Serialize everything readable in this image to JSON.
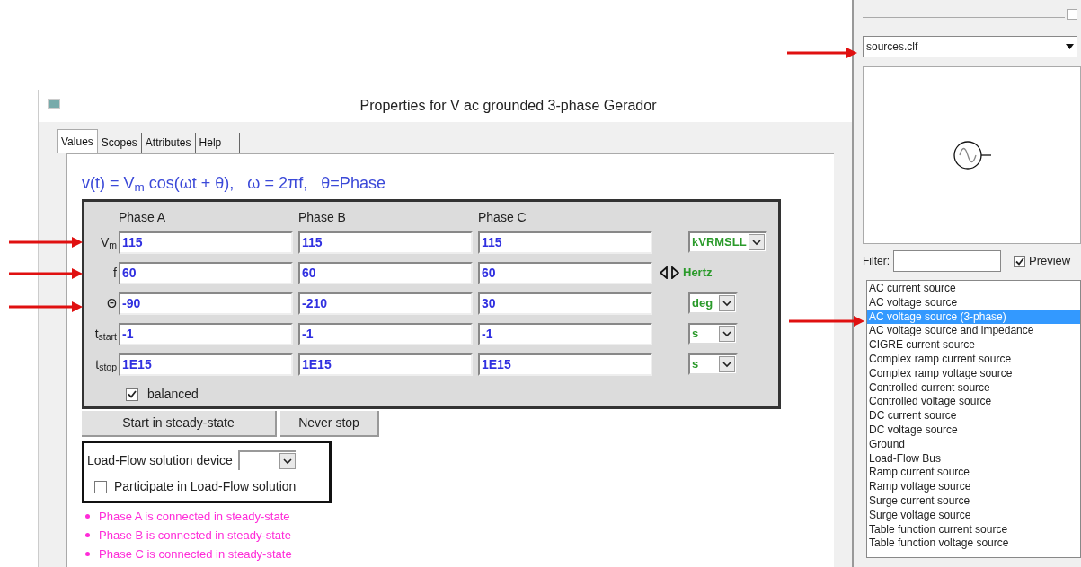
{
  "window": {
    "title": "Properties for V ac grounded 3-phase Gerador"
  },
  "tabs": [
    {
      "label": "Values",
      "selected": true
    },
    {
      "label": "Scopes",
      "selected": false
    },
    {
      "label": "Attributes",
      "selected": false
    },
    {
      "label": "Help",
      "selected": false
    }
  ],
  "formula": "v(t) = V$_{m}$ cos(ωt + θ),   ω = 2πf,   θ=Phase",
  "columns": [
    "Phase A",
    "Phase B",
    "Phase C"
  ],
  "rows": [
    {
      "label": "V$_{m}$",
      "values": [
        "115",
        "115",
        "115"
      ],
      "unit": {
        "kind": "select",
        "value": "kVRMSLL"
      }
    },
    {
      "label": "f",
      "values": [
        "60",
        "60",
        "60"
      ],
      "unit": {
        "kind": "spinner",
        "value": "Hertz"
      }
    },
    {
      "label": "Θ",
      "values": [
        "-90",
        "-210",
        "30"
      ],
      "unit": {
        "kind": "select",
        "value": "deg"
      }
    },
    {
      "label": "t$_{start}$",
      "values": [
        "-1",
        "-1",
        "-1"
      ],
      "unit": {
        "kind": "select",
        "value": "s"
      }
    },
    {
      "label": "t$_{stop}$",
      "values": [
        "1E15",
        "1E15",
        "1E15"
      ],
      "unit": {
        "kind": "select",
        "value": "s"
      }
    }
  ],
  "balanced": {
    "label": "balanced",
    "checked": true
  },
  "buttons": [
    "Start in steady-state",
    "Never stop"
  ],
  "load_flow": {
    "device_label": "Load-Flow solution device",
    "participate": {
      "label": "Participate in Load-Flow solution",
      "checked": false
    }
  },
  "messages": [
    "Phase A is connected in steady-state",
    "Phase B is connected in steady-state",
    "Phase C is connected in steady-state"
  ],
  "library": {
    "file": "sources.clf",
    "filter_label": "Filter:",
    "preview": {
      "label": "Preview",
      "checked": true
    },
    "items": [
      {
        "label": "AC current source",
        "selected": false
      },
      {
        "label": "AC voltage source",
        "selected": false
      },
      {
        "label": "AC voltage source (3-phase)",
        "selected": true
      },
      {
        "label": "AC voltage source and impedance",
        "selected": false
      },
      {
        "label": "CIGRE current source",
        "selected": false
      },
      {
        "label": "Complex ramp current source",
        "selected": false
      },
      {
        "label": "Complex ramp voltage source",
        "selected": false
      },
      {
        "label": "Controlled current source",
        "selected": false
      },
      {
        "label": "Controlled voltage source",
        "selected": false
      },
      {
        "label": "DC current source",
        "selected": false
      },
      {
        "label": "DC voltage source",
        "selected": false
      },
      {
        "label": "Ground",
        "selected": false
      },
      {
        "label": "Load-Flow Bus",
        "selected": false
      },
      {
        "label": "Ramp current source",
        "selected": false
      },
      {
        "label": "Ramp voltage source",
        "selected": false
      },
      {
        "label": "Surge current source",
        "selected": false
      },
      {
        "label": "Surge voltage source",
        "selected": false
      },
      {
        "label": "Table function current source",
        "selected": false
      },
      {
        "label": "Table function voltage source",
        "selected": false
      }
    ]
  }
}
